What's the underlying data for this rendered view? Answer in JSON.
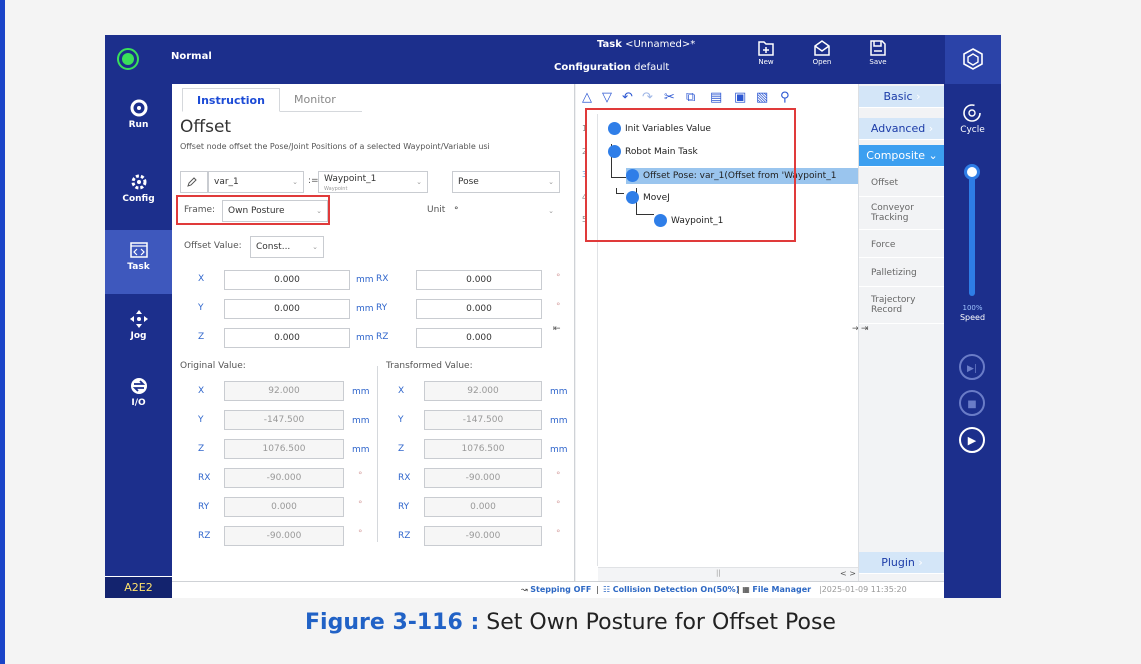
{
  "topbar": {
    "status": "Normal",
    "task_label": "Task",
    "task_value": "<Unnamed>*",
    "config_label": "Configuration",
    "config_value": "default",
    "buttons": {
      "new": "New",
      "open": "Open",
      "save": "Save"
    }
  },
  "leftnav": {
    "items": [
      {
        "label": "Run",
        "icon": "run-icon"
      },
      {
        "label": "Config",
        "icon": "config-icon"
      },
      {
        "label": "Task",
        "icon": "task-icon"
      },
      {
        "label": "Jog",
        "icon": "jog-icon"
      },
      {
        "label": "I/O",
        "icon": "io-icon"
      }
    ],
    "robot_id": "A2E2"
  },
  "instruction": {
    "tabs": [
      "Instruction",
      "Monitor"
    ],
    "title": "Offset",
    "description": "Offset node offset the Pose/Joint Positions of a selected Waypoint/Variable usi",
    "var_value": "var_1",
    "assign": ":=",
    "waypoint_value": "Waypoint_1",
    "waypoint_sub": "Waypoint",
    "pose_value": "Pose",
    "frame_label": "Frame:",
    "frame_value": "Own Posture",
    "unit_label": "Unit",
    "unit_value": "°",
    "offset_value_label": "Offset Value:",
    "offset_value": "Const...",
    "offset_rows": [
      {
        "axis": "X",
        "value": "0.000",
        "unit": "mm",
        "raxis": "RX",
        "rvalue": "0.000",
        "runit": "°"
      },
      {
        "axis": "Y",
        "value": "0.000",
        "unit": "mm",
        "raxis": "RY",
        "rvalue": "0.000",
        "runit": "°"
      },
      {
        "axis": "Z",
        "value": "0.000",
        "unit": "mm",
        "raxis": "RZ",
        "rvalue": "0.000",
        "runit": "°"
      }
    ],
    "original_label": "Original Value:",
    "transformed_label": "Transformed Value:",
    "original": [
      {
        "axis": "X",
        "value": "92.000",
        "unit": "mm"
      },
      {
        "axis": "Y",
        "value": "-147.500",
        "unit": "mm"
      },
      {
        "axis": "Z",
        "value": "1076.500",
        "unit": "mm"
      },
      {
        "axis": "RX",
        "value": "-90.000",
        "unit": "°"
      },
      {
        "axis": "RY",
        "value": "0.000",
        "unit": "°"
      },
      {
        "axis": "RZ",
        "value": "-90.000",
        "unit": "°"
      }
    ],
    "transformed": [
      {
        "axis": "X",
        "value": "92.000",
        "unit": "mm"
      },
      {
        "axis": "Y",
        "value": "-147.500",
        "unit": "mm"
      },
      {
        "axis": "Z",
        "value": "1076.500",
        "unit": "mm"
      },
      {
        "axis": "RX",
        "value": "-90.000",
        "unit": "°"
      },
      {
        "axis": "RY",
        "value": "0.000",
        "unit": "°"
      },
      {
        "axis": "RZ",
        "value": "-90.000",
        "unit": "°"
      }
    ]
  },
  "tree": {
    "line_numbers": [
      "1",
      "2",
      "3",
      "4",
      "5"
    ],
    "nodes": [
      {
        "label": "Init Variables Value"
      },
      {
        "label": "Robot Main Task"
      },
      {
        "label": "Offset Pose: var_1(Offset from 'Waypoint_1"
      },
      {
        "label": "MoveJ"
      },
      {
        "label": "Waypoint_1"
      }
    ]
  },
  "categories": {
    "basic": "Basic",
    "advanced": "Advanced",
    "composite": "Composite",
    "subitems": [
      "Offset",
      "Conveyor Tracking",
      "Force",
      "Palletizing",
      "Trajectory Record"
    ],
    "plugin": "Plugin"
  },
  "speed": {
    "mode": "Cycle",
    "value": "100%",
    "label": "Speed",
    "level_percent": 100
  },
  "statusbar": {
    "stepping": "Stepping OFF",
    "collision": "Collision Detection On(50%)",
    "file_manager": "File Manager",
    "timestamp": "2025-01-09 11:35:20"
  },
  "caption": {
    "figure": "Figure 3-116 :",
    "text": "Set Own Posture for Offset Pose"
  }
}
